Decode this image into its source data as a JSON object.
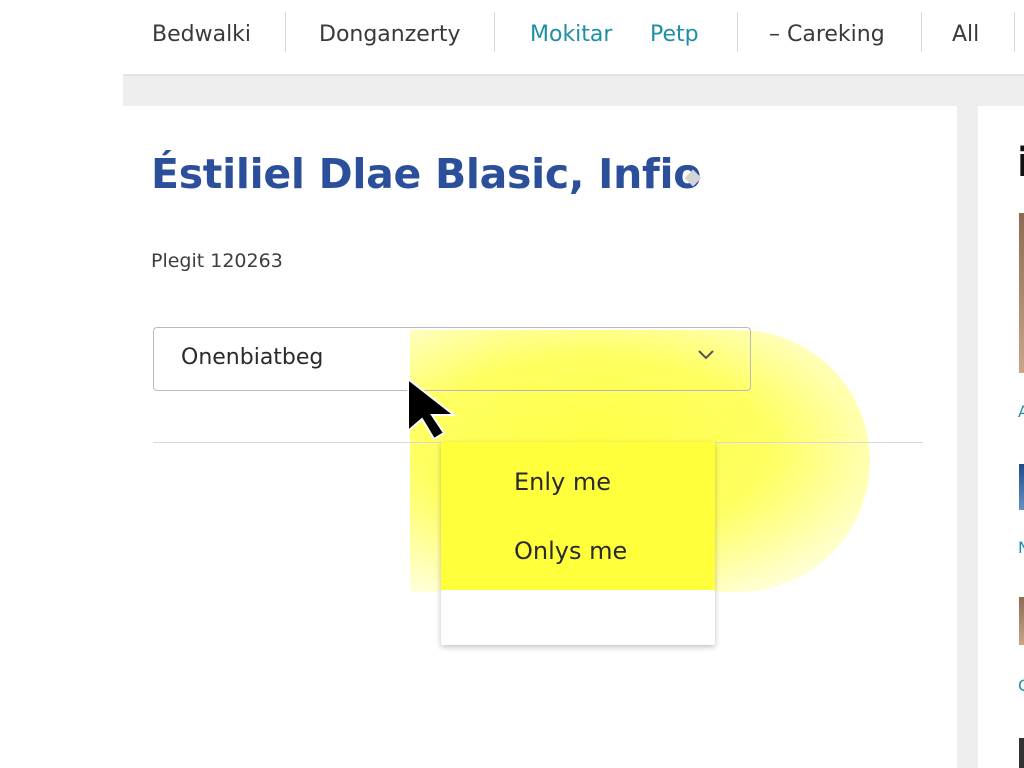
{
  "nav": {
    "items": [
      {
        "label": "Bedwalki"
      },
      {
        "label": "Donganzerty"
      },
      {
        "label": "Mokitar"
      },
      {
        "label": "Petp"
      },
      {
        "label": "– Careking"
      },
      {
        "label": "All"
      }
    ]
  },
  "main": {
    "title": "Éstiliel Dlae Blasic, Infio",
    "meta": "Plegit 120263",
    "select": {
      "value": "Onenbiatbeg",
      "options": [
        "Enly me",
        "Onlys me"
      ]
    }
  },
  "sidebar": {
    "heading_fragment": "i",
    "links": [
      "A",
      "N",
      "C"
    ]
  },
  "colors": {
    "title": "#2b4f9a",
    "nav_link": "#1e8fa5",
    "highlight": "#ffff3c"
  },
  "icons": [
    "diamond-icon",
    "chevron-down-icon",
    "mouse-cursor-icon"
  ]
}
